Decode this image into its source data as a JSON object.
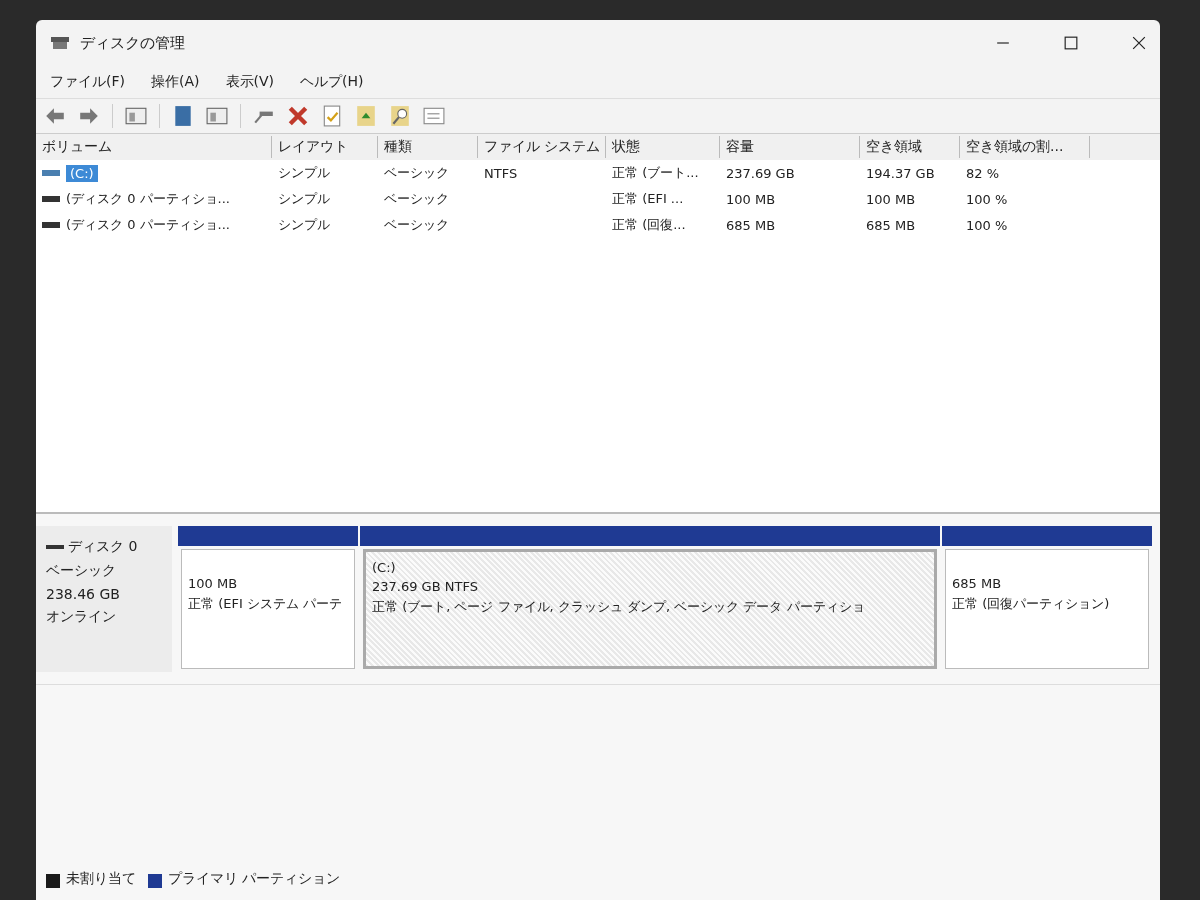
{
  "window": {
    "title": "ディスクの管理"
  },
  "menu": [
    "ファイル(F)",
    "操作(A)",
    "表示(V)",
    "ヘルプ(H)"
  ],
  "table": {
    "columns": [
      "ボリューム",
      "レイアウト",
      "種類",
      "ファイル システム",
      "状態",
      "容量",
      "空き領域",
      "空き領域の割..."
    ],
    "rows": [
      {
        "selected": true,
        "cells": [
          "(C:)",
          "シンプル",
          "ベーシック",
          "NTFS",
          "正常 (ブート...",
          "237.69 GB",
          "194.37 GB",
          "82 %"
        ]
      },
      {
        "selected": false,
        "cells": [
          "(ディスク 0 パーティショ...",
          "シンプル",
          "ベーシック",
          "",
          "正常 (EFI ...",
          "100 MB",
          "100 MB",
          "100 %"
        ]
      },
      {
        "selected": false,
        "cells": [
          "(ディスク 0 パーティショ...",
          "シンプル",
          "ベーシック",
          "",
          "正常 (回復...",
          "685 MB",
          "685 MB",
          "100 %"
        ]
      }
    ]
  },
  "disk": {
    "name": "ディスク 0",
    "type": "ベーシック",
    "size": "238.46 GB",
    "status": "オンライン",
    "partitions": [
      {
        "selected": false,
        "lines": [
          "100 MB",
          "正常 (EFI システム パーテ"
        ]
      },
      {
        "selected": true,
        "lines": [
          "(C:)",
          "237.69 GB NTFS",
          "正常 (ブート, ページ ファイル, クラッシュ ダンプ, ベーシック データ パーティショ"
        ]
      },
      {
        "selected": false,
        "lines": [
          "685 MB",
          "正常 (回復パーティション)"
        ]
      }
    ]
  },
  "legend": [
    {
      "label": "未割り当て",
      "color": "#1a1a1a"
    },
    {
      "label": "プライマリ パーティション",
      "color": "#1f3a93"
    }
  ]
}
